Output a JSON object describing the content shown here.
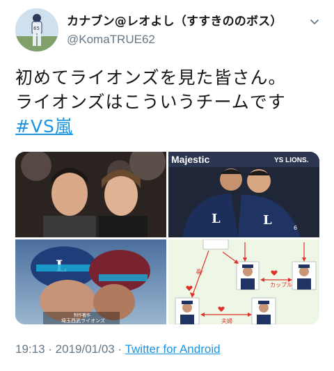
{
  "user": {
    "display_name": "カナブン@レオよし（すすきののボス）",
    "handle": "@KomaTRUE62"
  },
  "tweet": {
    "line1": "初めてライオンズを見た皆さん。",
    "line2": "ライオンズはこういうチームです",
    "hashtag": "#VS嵐"
  },
  "media": {
    "photo2_banner": "Majestic",
    "photo2_banner_right": "YS LIONS.",
    "photo3_caption1": "制作著作",
    "photo3_caption2": "埼玉西武ライオンズ",
    "diagram_label_kappuru": "カップル",
    "diagram_label_fuufu": "夫婦",
    "diagram_label_ai": "愛"
  },
  "footer": {
    "time": "19:13",
    "sep1": " · ",
    "date": "2019/01/03",
    "sep2": " · ",
    "source": "Twitter for Android"
  },
  "colors": {
    "link": "#1b95e0",
    "secondary": "#657786",
    "diagram_arrow": "#e0302a"
  },
  "icons": {
    "chevron": "chevron-down-icon"
  }
}
